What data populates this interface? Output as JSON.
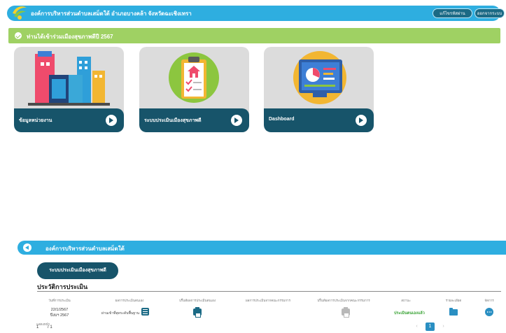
{
  "header": {
    "org_title": "องค์การบริหารส่วนตำบลเสม็ดใต้ อำเภอบางคล้า จังหวัดฉะเชิงเทรา",
    "edit_button": "แก้ไขรหัสผ่าน",
    "logout_button": "ออกจากระบบ"
  },
  "notice": {
    "text": "ท่านได้เข้าร่วมเมืองสุขภาพดีปี 2567"
  },
  "cards": [
    {
      "label": "ข้อมูลหน่วยงาน"
    },
    {
      "label": "ระบบประเมินเมืองสุขภาพดี"
    },
    {
      "label": "Dashboard"
    }
  ],
  "section": {
    "title": "องค์การบริหารส่วนตำบลเสม็ดใต้",
    "eval_button": "ระบบประเมินเมืองสุขภาพดี",
    "history_title": "ประวัติการประเมิน"
  },
  "table": {
    "columns": [
      "วันที่การประเมิน",
      "ผลการประเมินตนเอง",
      "ปริ้นท์ผลการประเมินตนเอง",
      "ผลการประเมินจากคณะกรรมการ",
      "ปริ้นท์ผลการประเมินจากคณะกรรมการ",
      "สถานะ",
      "รายละเอียด",
      "จัดการ"
    ],
    "rows": [
      {
        "date_line1": "22/1/2567",
        "date_line2": "ปีงบฯ 2567",
        "self_result": "ผ่านเข้าที่สุดระดับพื้นฐาน",
        "status": "ประเมินตนเองแล้ว"
      }
    ]
  },
  "pagination": {
    "label": "แสดงหน้า",
    "page_input": "1",
    "total": "/ 1",
    "current": "1",
    "prev": "‹",
    "next": "›"
  },
  "colors": {
    "primary": "#2eaee0",
    "dark": "#17546a",
    "notice": "#9fd163",
    "status": "#39a335"
  }
}
